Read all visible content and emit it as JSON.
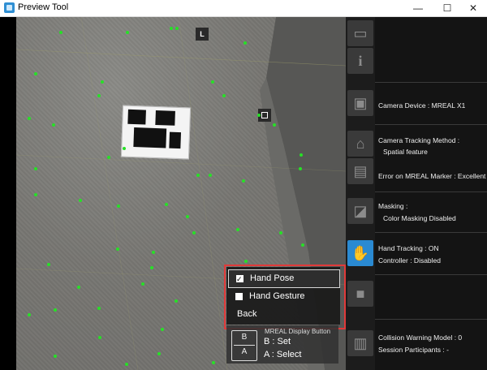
{
  "window": {
    "title": "Preview Tool",
    "minimize": "—",
    "maximize": "☐",
    "close": "✕"
  },
  "scene": {
    "marker_top_left_tag": "L"
  },
  "menu": {
    "items": [
      {
        "label": "Hand Pose",
        "checked": true
      },
      {
        "label": "Hand Gesture",
        "checked": false
      }
    ],
    "back_label": "Back",
    "highlight_color": "#e03a3a"
  },
  "display_button": {
    "title": "MREAL Display Button",
    "key_b": "B",
    "key_a": "A",
    "b_action": "B : Set",
    "a_action": "A : Select"
  },
  "status": {
    "camera_device": "Camera Device : MREAL X1",
    "tracking_method_label": "Camera Tracking Method :",
    "tracking_method_value": "Spatial feature",
    "marker_error": "Error on MREAL Marker : Excellent",
    "masking_label": "Masking :",
    "masking_value": "Color Masking Disabled",
    "hand_tracking": "Hand Tracking : ON",
    "controller": "Controller : Disabled",
    "collision_model": "Collision Warning Model : 0",
    "session_participants": "Session Participants : -"
  },
  "toolbar_icons": [
    "hmd-icon",
    "info-icon",
    "camera-device-icon",
    "tracking-icon",
    "marker-icon",
    "masking-icon",
    "hand-tracking-icon",
    "video-camera-icon",
    "collision-icon"
  ],
  "colors": {
    "accent": "#2a8ad2",
    "feature_point": "#27e027"
  }
}
